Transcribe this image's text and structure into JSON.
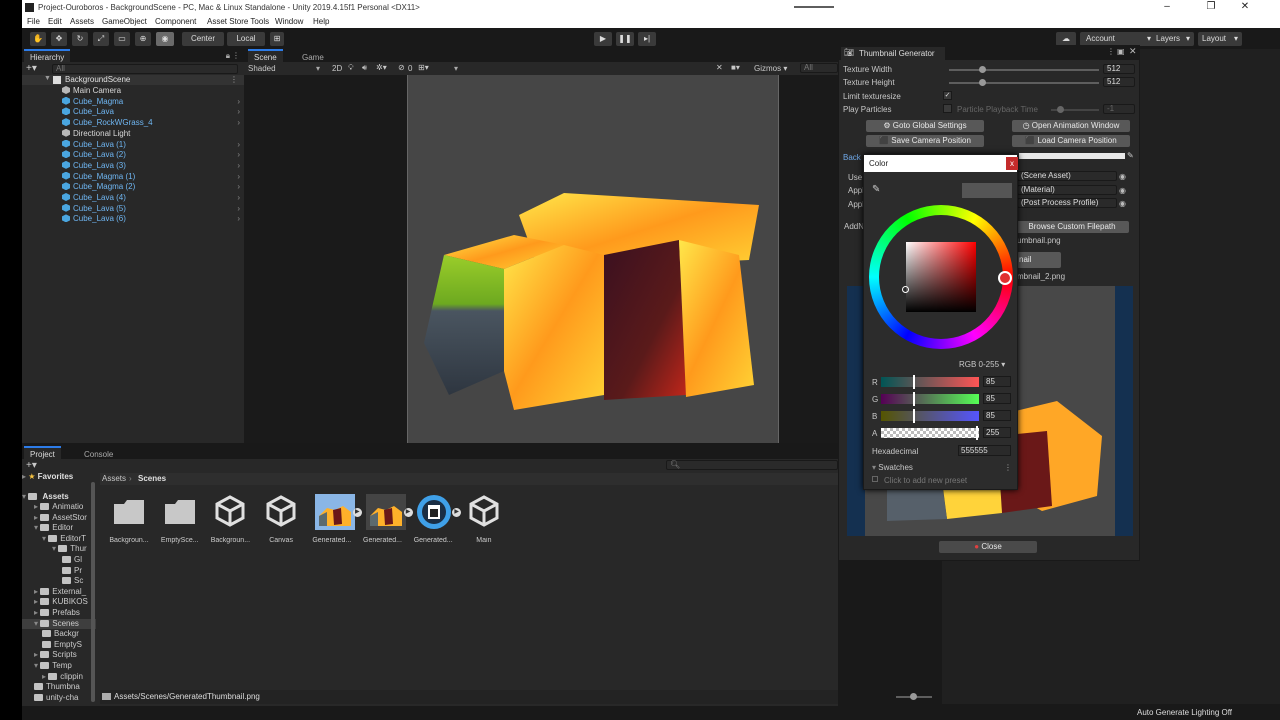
{
  "window": {
    "title": "Project-Ouroboros - BackgroundScene - PC, Mac & Linux Standalone - Unity 2019.4.15f1 Personal <DX11>",
    "controls": [
      "–",
      "❐",
      "✕"
    ]
  },
  "menu": [
    "File",
    "Edit",
    "Assets",
    "GameObject",
    "Component",
    "Asset Store Tools",
    "Window",
    "Help"
  ],
  "toolbar": {
    "pivot_center": "Center",
    "pivot_local": "Local",
    "account": "Account",
    "layers": "Layers",
    "layout": "Layout"
  },
  "hierarchy": {
    "tab": "Hierarchy",
    "search_placeholder": "All",
    "scene": "BackgroundScene",
    "items": [
      {
        "label": "Main Camera",
        "type": "go"
      },
      {
        "label": "Cube_Magma",
        "type": "prefab"
      },
      {
        "label": "Cube_Lava",
        "type": "prefab"
      },
      {
        "label": "Cube_RockWGrass_4",
        "type": "prefab"
      },
      {
        "label": "Directional Light",
        "type": "go"
      },
      {
        "label": "Cube_Lava (1)",
        "type": "prefab"
      },
      {
        "label": "Cube_Lava (2)",
        "type": "prefab"
      },
      {
        "label": "Cube_Lava (3)",
        "type": "prefab"
      },
      {
        "label": "Cube_Magma (1)",
        "type": "prefab"
      },
      {
        "label": "Cube_Magma (2)",
        "type": "prefab"
      },
      {
        "label": "Cube_Lava (4)",
        "type": "prefab"
      },
      {
        "label": "Cube_Lava (5)",
        "type": "prefab"
      },
      {
        "label": "Cube_Lava (6)",
        "type": "prefab"
      }
    ]
  },
  "scene": {
    "tab_scene": "Scene",
    "tab_game": "Game",
    "shading": "Shaded",
    "mode_2d": "2D",
    "gizmo_count": "0",
    "gizmos": "Gizmos",
    "search_placeholder": "All"
  },
  "project": {
    "tab_project": "Project",
    "tab_console": "Console",
    "favorites": "Favorites",
    "assets": "Assets",
    "breadcrumb_root": "Assets",
    "breadcrumb_current": "Scenes",
    "tree": [
      "Animatio",
      "AssetStor",
      "Editor",
      "EditorT",
      "Thur",
      "Gl",
      "Pr",
      "Sc",
      "External_",
      "KUBIKOS",
      "Prefabs",
      "Scenes",
      "Backgr",
      "EmptyS",
      "Scripts",
      "Temp",
      "clippin",
      "Thumbna",
      "unity-cha"
    ],
    "files": [
      {
        "label": "Backgroun...",
        "kind": "folder"
      },
      {
        "label": "EmptySce...",
        "kind": "folder"
      },
      {
        "label": "Backgroun...",
        "kind": "unity"
      },
      {
        "label": "Canvas",
        "kind": "unity"
      },
      {
        "label": "Generated...",
        "kind": "thumb1"
      },
      {
        "label": "Generated...",
        "kind": "thumb2"
      },
      {
        "label": "Generated...",
        "kind": "icon"
      },
      {
        "label": "Main",
        "kind": "unity"
      }
    ],
    "status_path": "Assets/Scenes/GeneratedThumbnail.png"
  },
  "thumbnail_generator": {
    "title": "Thumbnail Generator",
    "texture_width_label": "Texture Width",
    "texture_width": "512",
    "texture_height_label": "Texture Height",
    "texture_height": "512",
    "limit_label": "Limit texturesize",
    "play_particles_label": "Play Particles",
    "particle_playback_label": "Particle Playback Time",
    "particle_playback_value": "-1",
    "goto_global": "Goto Global Settings",
    "open_anim": "Open Animation Window",
    "save_cam": "Save Camera Position",
    "load_cam": "Load Camera Position",
    "back_label": "Back",
    "use_label": "Use",
    "appl1": "Appl",
    "appl2": "Appl",
    "addn": "AddN",
    "scene_asset": "(Scene Asset)",
    "material": "(Material)",
    "post_process": "(Post Process Profile)",
    "browse": "Browse Custom Filepath",
    "filename": "umbnail.png",
    "generate_frag": "nail",
    "filename2": "mbnail_2.png",
    "close": "Close"
  },
  "color_picker": {
    "title": "Color",
    "mode": "RGB 0-255",
    "r_label": "R",
    "r": "85",
    "g_label": "G",
    "g": "85",
    "b_label": "B",
    "b": "85",
    "a_label": "A",
    "a": "255",
    "hex_label": "Hexadecimal",
    "hex": "555555",
    "swatches": "Swatches",
    "add_preset": "Click to add new preset",
    "current_color": "#555555"
  },
  "status_bar": {
    "lighting": "Auto Generate Lighting Off"
  },
  "colors": {
    "accent": "#2d7ce8",
    "prefab_text": "#6fb6f2",
    "panel": "#282828",
    "dark": "#191919"
  }
}
